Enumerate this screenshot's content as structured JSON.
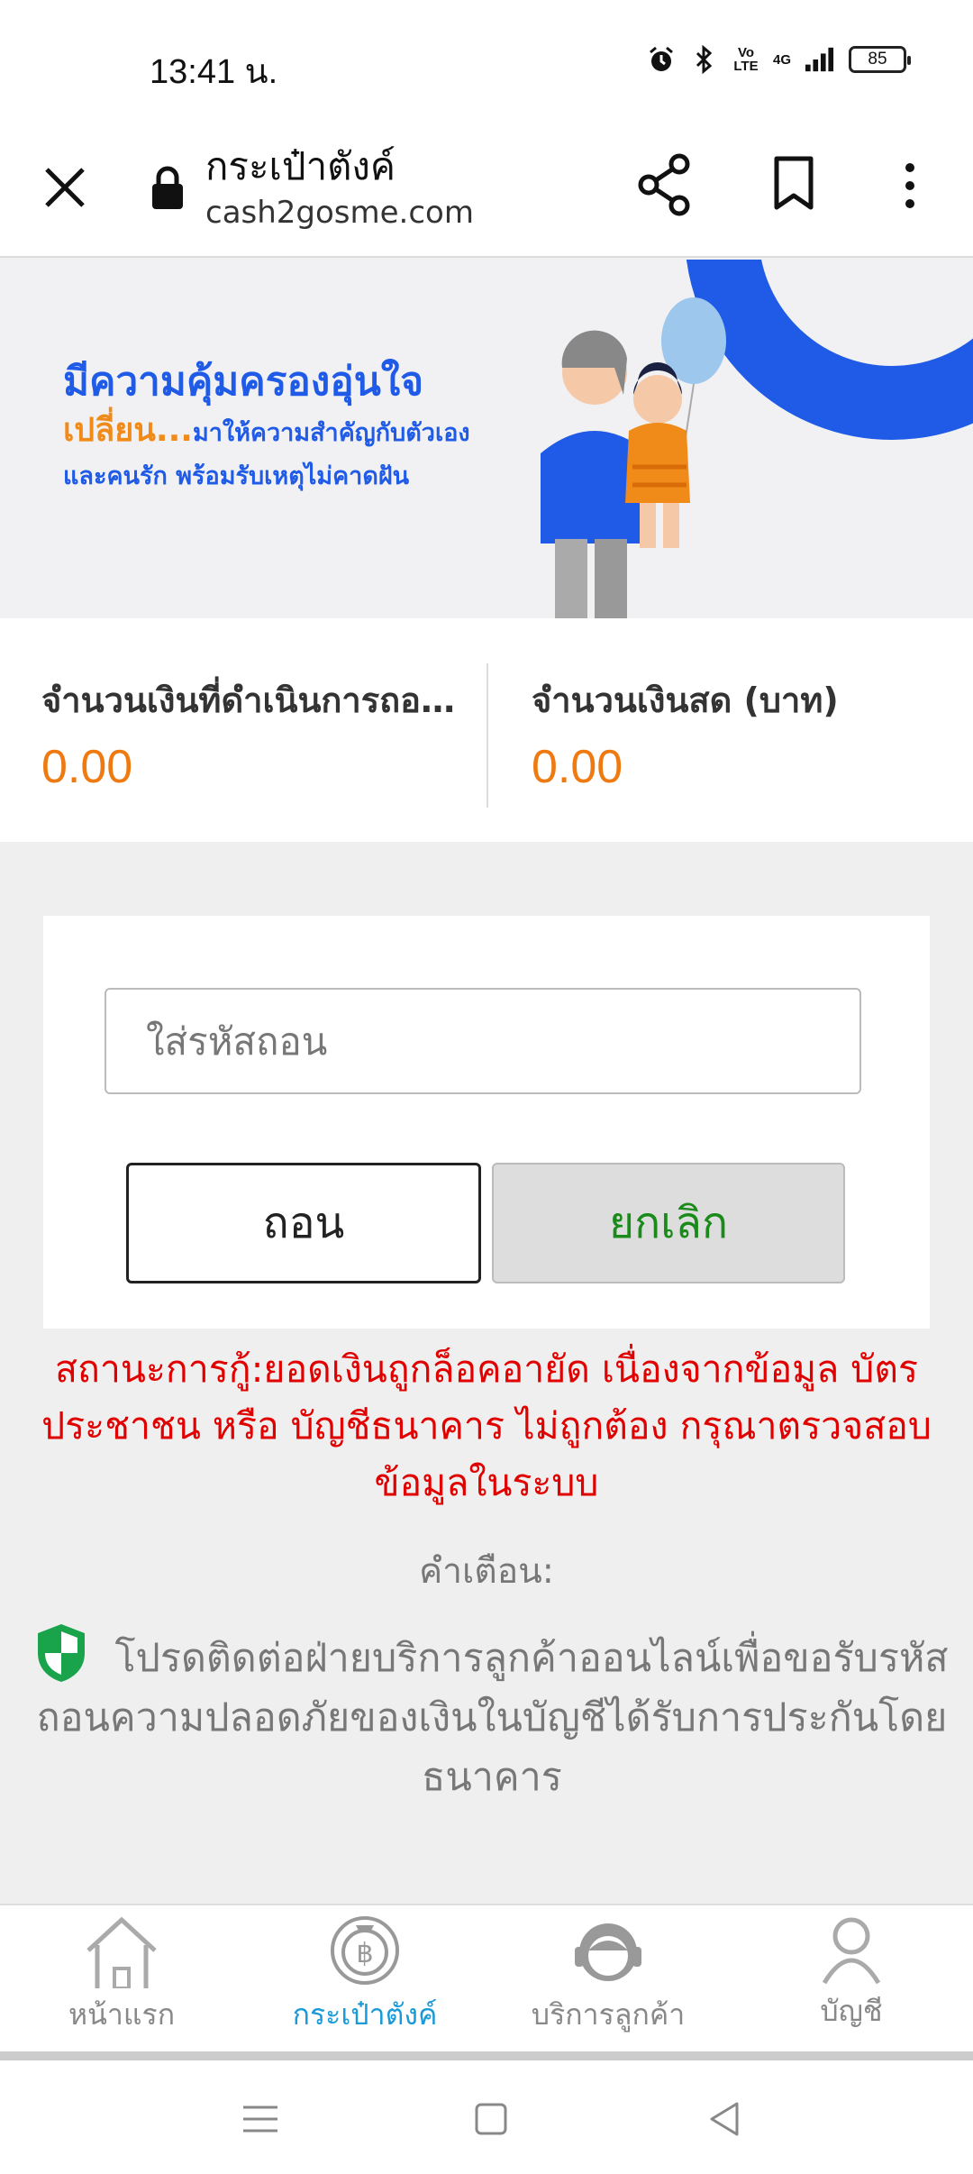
{
  "status_bar": {
    "time": "13:41 น.",
    "volte": "Vo LTE",
    "network": "4G",
    "battery": "85",
    "icons": [
      "alarm-icon",
      "bluetooth-icon",
      "volte-icon",
      "signal-icon",
      "battery-icon"
    ]
  },
  "browser": {
    "title": "กระเป๋าตังค์",
    "url": "cash2gosme.com",
    "icons": [
      "close-icon",
      "lock-icon",
      "share-icon",
      "bookmark-icon",
      "more-vert-icon"
    ]
  },
  "banner": {
    "line1": "มีความคุ้มครองอุ่นใจ",
    "line2_highlight": "เปลี่ยน...",
    "line2_rest": "มาให้ความสำคัญกับตัวเอง",
    "line3": "และคนรัก พร้อมรับเหตุไม่คาดฝัน"
  },
  "amounts": {
    "processing_label": "จำนวนเงินที่ดำเนินการถอน (บาท)",
    "processing_value": "0.00",
    "cash_label": "จำนวนเงินสด (บาท)",
    "cash_value": "0.00"
  },
  "form": {
    "code_placeholder": "ใส่รหัสถอน",
    "withdraw_label": "ถอน",
    "cancel_label": "ยกเลิก"
  },
  "status_message": "สถานะการกู้:ยอดเงินถูกล็อคอายัด เนื่องจากข้อมูล บัตรประชาชน หรือ บัญชีธนาคาร ไม่ถูกต้อง กรุณาตรวจสอบข้อมูลในระบบ",
  "warning": {
    "title": "คำเตือน:",
    "body": "โปรดติดต่อฝ่ายบริการลูกค้าออนไลน์เพื่อขอรับรหัสถอนความปลอดภัยของเงินในบัญชีได้รับการประกันโดยธนาคาร"
  },
  "tabs": [
    {
      "label": "หน้าแรก",
      "icon": "home-icon"
    },
    {
      "label": "กระเป๋าตังค์",
      "icon": "baht-bag-icon",
      "active": true
    },
    {
      "label": "บริการลูกค้า",
      "icon": "customer-service-icon"
    },
    {
      "label": "บัญชี",
      "icon": "account-icon"
    }
  ],
  "colors": {
    "accent_blue": "#1f5be6",
    "amount_orange": "#ee7a12",
    "error_red": "#e00000",
    "cancel_green": "#1a8a1a",
    "active_tab": "#1a9bd7"
  }
}
